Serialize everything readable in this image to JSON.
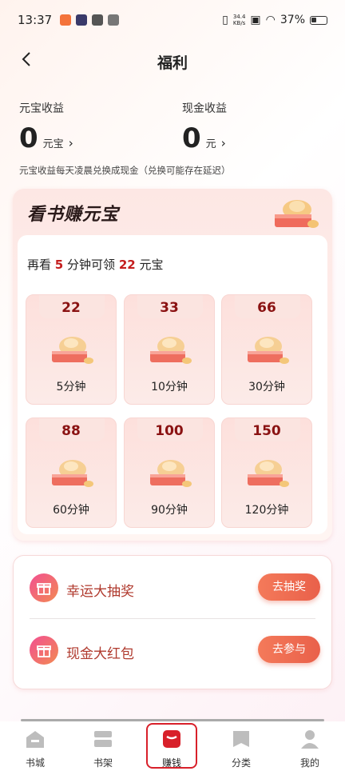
{
  "status_bar": {
    "time": "13:37",
    "speed_top": "34.4",
    "speed_bottom": "KB/s",
    "battery": "37%"
  },
  "header": {
    "title": "福利",
    "back_icon": "chevron-left-icon"
  },
  "earnings": {
    "ingot": {
      "label": "元宝收益",
      "value": "0",
      "unit": "元宝",
      "chevron": "›"
    },
    "cash": {
      "label": "现金收益",
      "value": "0",
      "unit": "元",
      "chevron": "›"
    }
  },
  "note": "元宝收益每天凌晨兑换成现金（兑换可能存在延迟）",
  "reading_card": {
    "title": "看书赚元宝",
    "hint_prefix": "再看",
    "hint_minutes": "5",
    "hint_middle": "分钟可领",
    "hint_reward": "22",
    "hint_suffix": "元宝",
    "tiles": [
      {
        "value": "22",
        "label": "5分钟"
      },
      {
        "value": "33",
        "label": "10分钟"
      },
      {
        "value": "66",
        "label": "30分钟"
      },
      {
        "value": "88",
        "label": "60分钟"
      },
      {
        "value": "100",
        "label": "90分钟"
      },
      {
        "value": "150",
        "label": "120分钟"
      }
    ]
  },
  "activities": [
    {
      "label": "幸运大抽奖",
      "button": "去抽奖",
      "icon": "gift-icon"
    },
    {
      "label": "现金大红包",
      "button": "去参与",
      "icon": "gift-icon"
    }
  ],
  "tabbar": {
    "items": [
      {
        "label": "书城",
        "icon": "bookstore-icon"
      },
      {
        "label": "书架",
        "icon": "bookshelf-icon"
      },
      {
        "label": "赚钱",
        "icon": "earn-money-icon",
        "active": true
      },
      {
        "label": "分类",
        "icon": "category-icon"
      },
      {
        "label": "我的",
        "icon": "profile-icon"
      }
    ]
  },
  "colors": {
    "accent_red": "#c41d1d",
    "button_orange": "#e9604a",
    "tab_gray": "#bdbdbd",
    "active_red": "#d8202a"
  }
}
